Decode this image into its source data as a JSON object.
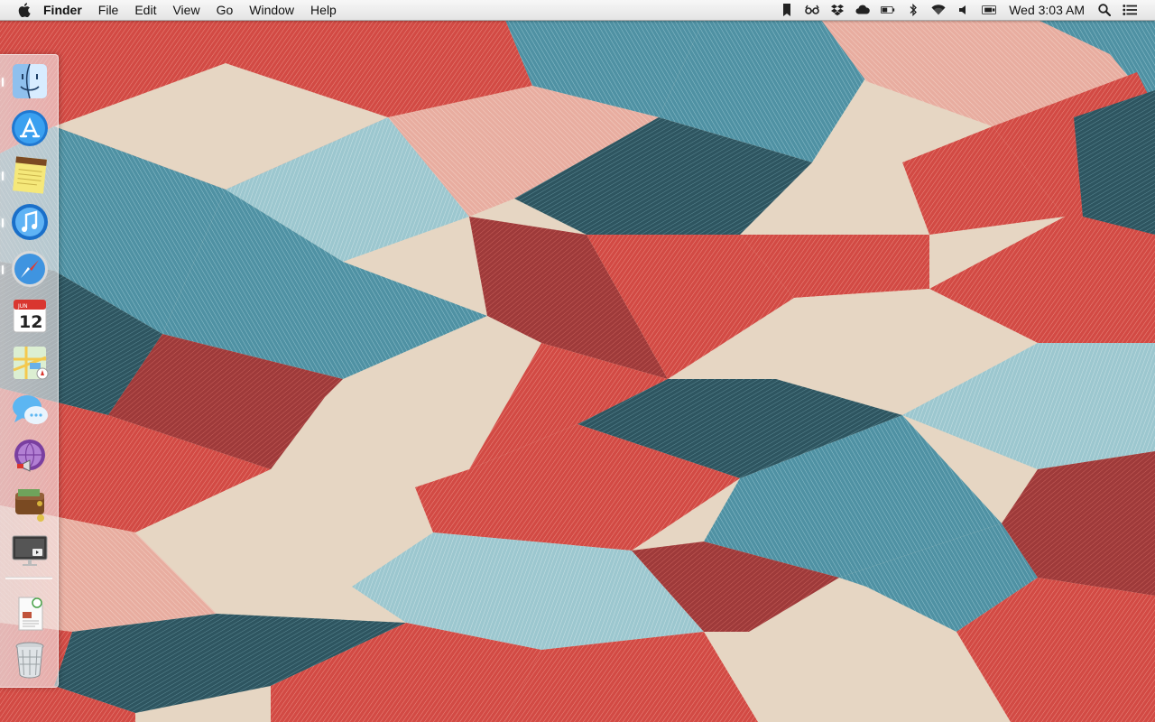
{
  "menubar": {
    "app_name": "Finder",
    "menus": [
      "File",
      "Edit",
      "View",
      "Go",
      "Window",
      "Help"
    ],
    "status_items": [
      "bookmark-icon",
      "glasses-icon",
      "dropbox-icon",
      "cloud-icon",
      "battery-icon",
      "bluetooth-icon",
      "wifi-icon",
      "volume-icon",
      "display-icon"
    ],
    "clock": "Wed 3:03 AM"
  },
  "dock": {
    "items": [
      {
        "name": "finder",
        "running": true
      },
      {
        "name": "app-store",
        "running": false
      },
      {
        "name": "notes",
        "running": true
      },
      {
        "name": "itunes",
        "running": true
      },
      {
        "name": "safari",
        "running": true
      },
      {
        "name": "calendar",
        "running": false,
        "month": "JUN",
        "day": "12"
      },
      {
        "name": "maps",
        "running": false
      },
      {
        "name": "messages",
        "running": false
      },
      {
        "name": "podcast",
        "running": false
      },
      {
        "name": "wallet",
        "running": false
      },
      {
        "name": "dvd-player",
        "running": false
      },
      {
        "name": "preview-document",
        "running": false
      },
      {
        "name": "trash",
        "running": false
      }
    ]
  },
  "colors": {
    "red": "#d24a44",
    "blue": "#4b8fa2",
    "cream": "#e6d6c3",
    "dark": "#2a4a55",
    "pink": "#e39a8e"
  }
}
